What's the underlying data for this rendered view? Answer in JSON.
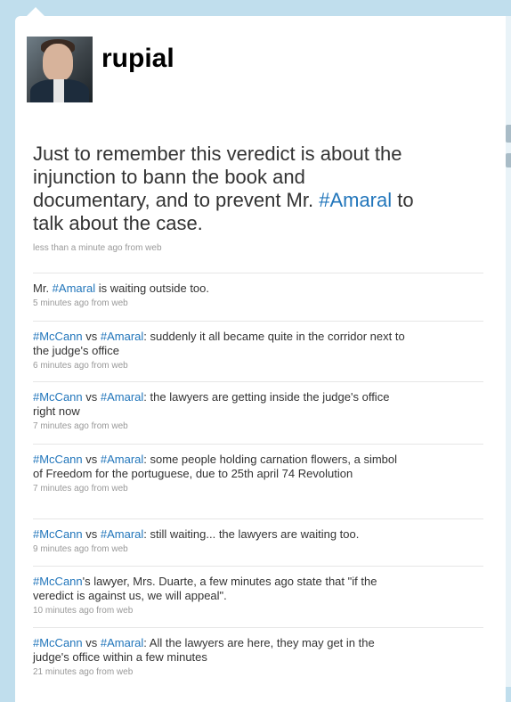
{
  "profile": {
    "screen_name": "rupial",
    "avatar_icon": "user-photo-avatar"
  },
  "main_tweet": {
    "parts": [
      {
        "text": "Just to remember this veredict is about the injunction to bann the book and documentary, and to prevent Mr. ",
        "tag": false
      },
      {
        "text": "#Amaral",
        "tag": true
      },
      {
        "text": " to talk about the case.",
        "tag": false
      }
    ],
    "meta": "less than a minute ago from web"
  },
  "timeline": [
    {
      "parts": [
        {
          "text": "Mr. ",
          "tag": false
        },
        {
          "text": "#Amaral",
          "tag": true
        },
        {
          "text": " is waiting outside too.",
          "tag": false
        }
      ],
      "meta": "5 minutes ago from web"
    },
    {
      "parts": [
        {
          "text": "#McCann",
          "tag": true
        },
        {
          "text": " vs ",
          "tag": false
        },
        {
          "text": "#Amaral",
          "tag": true
        },
        {
          "text": ": suddenly it all became quite in the corridor next to the judge's office",
          "tag": false
        }
      ],
      "meta": "6 minutes ago from web"
    },
    {
      "parts": [
        {
          "text": "#McCann",
          "tag": true
        },
        {
          "text": " vs ",
          "tag": false
        },
        {
          "text": "#Amaral",
          "tag": true
        },
        {
          "text": ": the lawyers are getting inside the judge's office right now",
          "tag": false
        }
      ],
      "meta": "7 minutes ago from web"
    },
    {
      "parts": [
        {
          "text": "#McCann",
          "tag": true
        },
        {
          "text": " vs ",
          "tag": false
        },
        {
          "text": "#Amaral",
          "tag": true
        },
        {
          "text": ": some people holding carnation flowers, a simbol of Freedom for the portuguese, due to 25th april 74 Revolution",
          "tag": false
        }
      ],
      "meta": "7 minutes ago from web"
    },
    {
      "parts": [
        {
          "text": "#McCann",
          "tag": true
        },
        {
          "text": " vs ",
          "tag": false
        },
        {
          "text": "#Amaral",
          "tag": true
        },
        {
          "text": ": still waiting... the lawyers are waiting too.",
          "tag": false
        }
      ],
      "meta": "9 minutes ago from web"
    },
    {
      "parts": [
        {
          "text": "#McCann",
          "tag": true
        },
        {
          "text": "'s lawyer, Mrs. Duarte, a few minutes ago state that \"if the veredict is against us, we will appeal\".",
          "tag": false
        }
      ],
      "meta": "10 minutes ago from web"
    },
    {
      "parts": [
        {
          "text": "#McCann",
          "tag": true
        },
        {
          "text": " vs ",
          "tag": false
        },
        {
          "text": "#Amaral",
          "tag": true
        },
        {
          "text": ": All the lawyers are here, they may get in the judge's office within a few minutes",
          "tag": false
        }
      ],
      "meta": "21 minutes ago from web"
    }
  ],
  "colors": {
    "background": "#c0deed",
    "link": "#2276bb",
    "text": "#333333",
    "meta": "#999999"
  }
}
